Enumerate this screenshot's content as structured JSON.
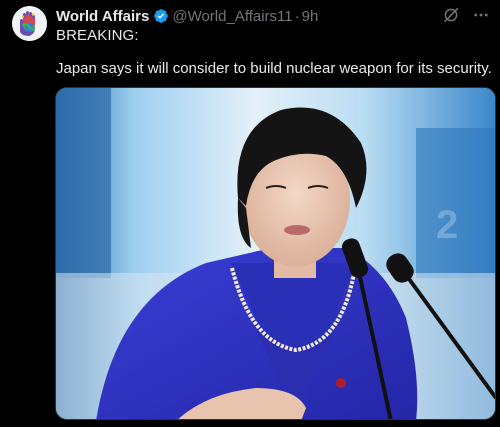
{
  "tweet": {
    "display_name": "World Affairs",
    "handle": "@World_Affairs11",
    "separator": "·",
    "timestamp": "9h",
    "line1": "BREAKING:",
    "body": "Japan says it will consider to build nuclear weapon for its security."
  },
  "icons": {
    "verified": "verified-badge-icon",
    "grok": "grok-icon",
    "more": "more-options-icon",
    "avatar": "globe-hand-avatar"
  },
  "colors": {
    "background": "#000000",
    "text_primary": "#e7e9ea",
    "text_secondary": "#71767b",
    "verified_blue": "#1d9bf0"
  }
}
